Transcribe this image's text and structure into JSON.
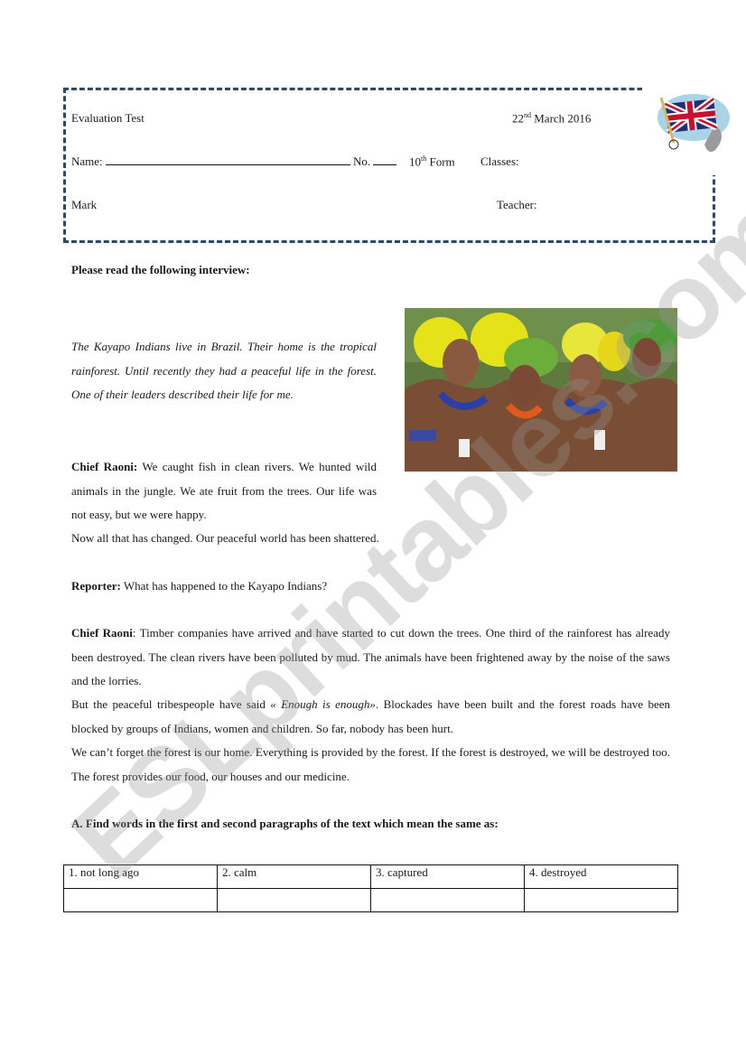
{
  "header": {
    "title": "Evaluation Test",
    "date_day": "22",
    "date_suffix": "nd",
    "date_rest": " March 2016",
    "name_label": "Name:",
    "number_label": "No.",
    "form_number": "10",
    "form_suffix": "th",
    "form_label": " Form",
    "classes_label": "Classes:",
    "mark_label": "Mark",
    "teacher_label": "Teacher:",
    "flag_icon": "union-jack-flag-icon"
  },
  "instruction": "Please read the following interview:",
  "photo": {
    "description": "Kayapo Indian chiefs wearing feather headdresses"
  },
  "intro_paragraph": "The Kayapo Indians live in Brazil. Their home is the tropical rainforest. Until recently they had a peaceful life in the forest. One of their leaders described their life for me.",
  "interview": [
    {
      "speaker": "Chief Raoni:",
      "text": " We caught fish in clean rivers. We hunted wild animals in the jungle. We ate fruit from the trees. Our life was not easy, but we were happy.",
      "text2": "Now all that has changed. Our peaceful world has been shattered."
    },
    {
      "speaker": "Reporter:",
      "text": " What has happened to the Kayapo Indians?"
    },
    {
      "speaker": "Chief Raoni",
      "text": ": Timber companies have arrived and have started to cut down the trees. One third of the rainforest has already been destroyed. The clean rivers have been polluted by mud. The animals have been frightened away by the noise of the saws and the lorries.",
      "text2_a": "But the peaceful tribespeople have said ",
      "text2_quote": "« Enough is enough»",
      "text2_b": ". Blockades have been built and the forest roads have been blocked by groups of Indians, women and children. So far, nobody has been hurt.",
      "text3": "We can’t forget the forest is our home. Everything is provided by the forest. If the forest is destroyed, we will be destroyed too. The forest provides our food, our houses and our medicine."
    }
  ],
  "exercise_a": {
    "question": "A. Find words in the first and second paragraphs of the text which mean the same as:",
    "items": [
      "1. not long ago",
      "2. calm",
      "3. captured",
      "4. destroyed"
    ],
    "answers": [
      "",
      "",
      "",
      ""
    ]
  },
  "watermark": "ESLprintables.com"
}
